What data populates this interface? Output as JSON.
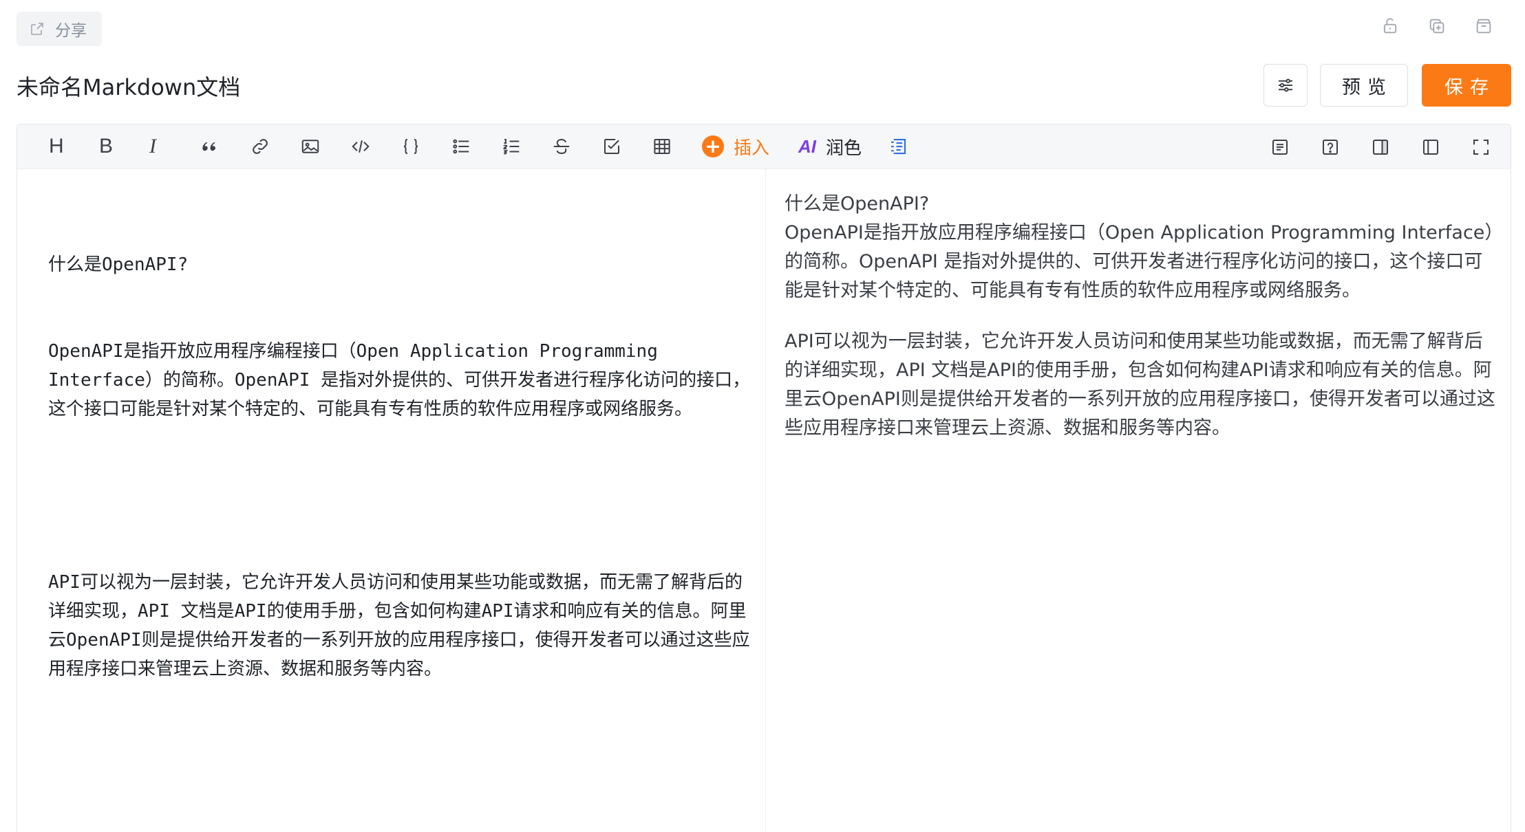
{
  "header": {
    "share_label": "分享",
    "doc_title": "未命名Markdown文档",
    "preview_label": "预览",
    "save_label": "保存",
    "top_icons": [
      "unlock-icon",
      "copy-icon",
      "archive-icon"
    ]
  },
  "toolbar": {
    "heading_label": "H",
    "bold_label": "B",
    "italic_label": "I",
    "insert_label": "插入",
    "ai_label": "AI",
    "polish_label": "润色",
    "accent_color": "#fb7a16",
    "ai_color": "#7b3fe4"
  },
  "editor": {
    "source": {
      "line1": "什么是OpenAPI?",
      "para1": "OpenAPI是指开放应用程序编程接口（Open Application Programming Interface）的简称。OpenAPI 是指对外提供的、可供开发者进行程序化访问的接口，这个接口可能是针对某个特定的、可能具有专有性质的软件应用程序或网络服务。",
      "para2": "API可以视为一层封装，它允许开发人员访问和使用某些功能或数据，而无需了解背后的详细实现，API 文档是API的使用手册，包含如何构建API请求和响应有关的信息。阿里云OpenAPI则是提供给开发者的一系列开放的应用程序接口，使得开发者可以通过这些应用程序接口来管理云上资源、数据和服务等内容。"
    },
    "preview": {
      "line1": "什么是OpenAPI?",
      "para1": "OpenAPI是指开放应用程序编程接口（Open Application Programming Interface）的简称。OpenAPI 是指对外提供的、可供开发者进行程序化访问的接口，这个接口可能是针对某个特定的、可能具有专有性质的软件应用程序或网络服务。",
      "para2": "API可以视为一层封装，它允许开发人员访问和使用某些功能或数据，而无需了解背后的详细实现，API 文档是API的使用手册，包含如何构建API请求和响应有关的信息。阿里云OpenAPI则是提供给开发者的一系列开放的应用程序接口，使得开发者可以通过这些应用程序接口来管理云上资源、数据和服务等内容。"
    }
  }
}
